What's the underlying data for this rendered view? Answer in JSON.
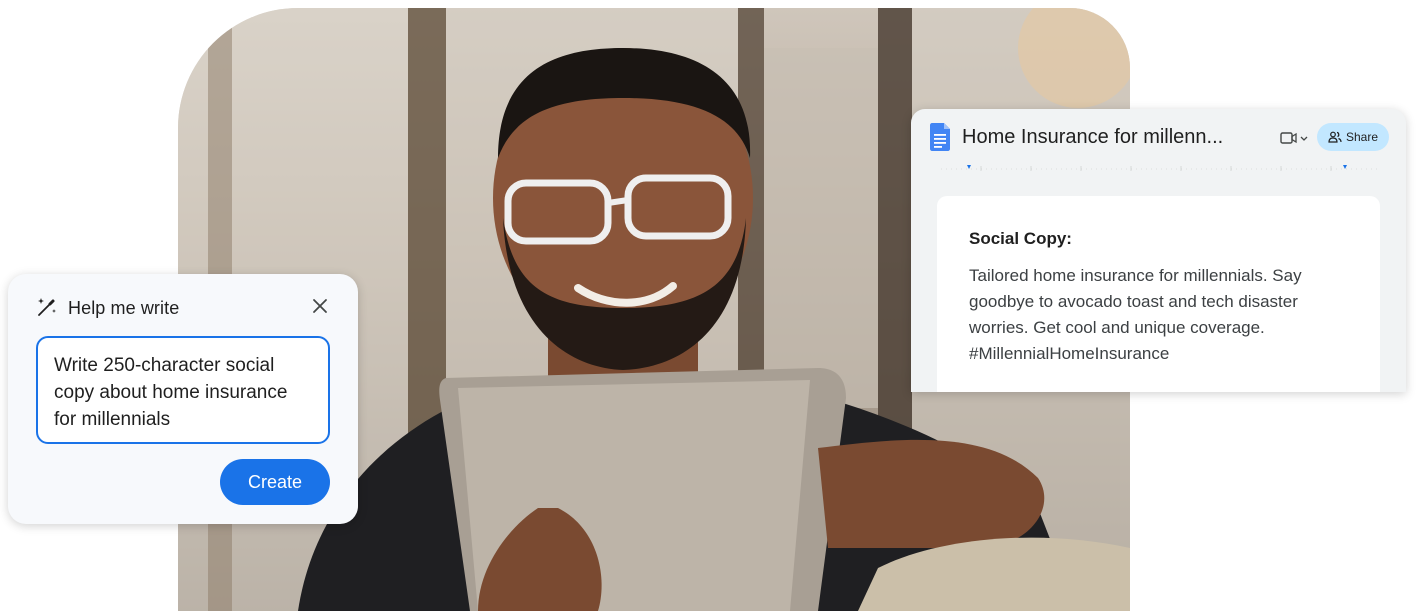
{
  "help_me_write": {
    "title": "Help me write",
    "prompt": "Write 250-character social copy about home insurance for millennials",
    "create_label": "Create",
    "icons": {
      "pen": "pen-sparkle-icon",
      "close": "close-icon"
    }
  },
  "docs": {
    "doc_title": "Home Insurance for millenn...",
    "share_label": "Share",
    "icons": {
      "logo": "google-docs-icon",
      "meet": "video-call-icon",
      "share": "people-icon"
    },
    "content": {
      "heading": "Social Copy:",
      "body": "Tailored home insurance for millennials. Say goodbye to avocado toast and tech disaster worries. Get cool and unique coverage. #MillennialHomeInsurance"
    }
  },
  "colors": {
    "accent": "#1a73e8",
    "share_bg": "#c2e7ff",
    "card_bg": "#f7f9fc",
    "docs_bg": "#f1f3f4"
  }
}
